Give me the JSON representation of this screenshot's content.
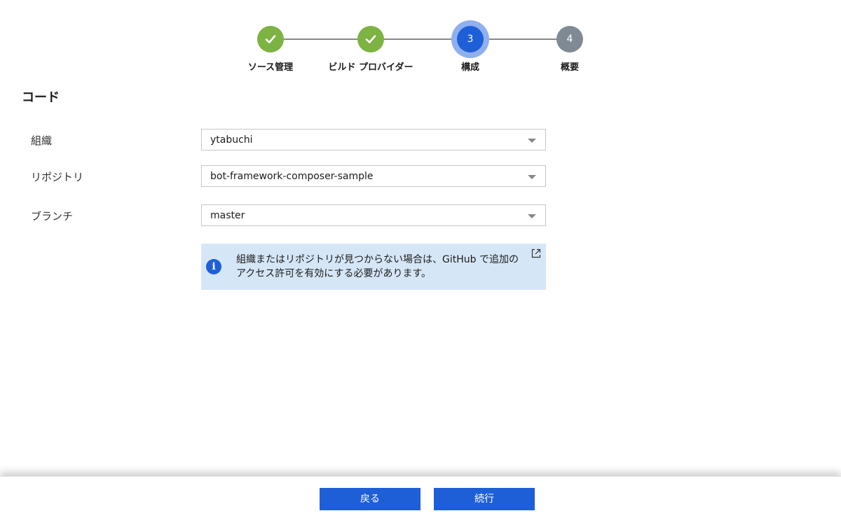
{
  "stepper": {
    "steps": [
      {
        "label": "ソース管理",
        "state": "done",
        "number": "1"
      },
      {
        "label": "ビルド プロバイダー",
        "state": "done",
        "number": "2"
      },
      {
        "label": "構成",
        "state": "current",
        "number": "3"
      },
      {
        "label": "概要",
        "state": "pending",
        "number": "4"
      }
    ]
  },
  "section": {
    "title": "コード"
  },
  "form": {
    "organization": {
      "label": "組織",
      "value": "ytabuchi"
    },
    "repository": {
      "label": "リポジトリ",
      "value": "bot-framework-composer-sample"
    },
    "branch": {
      "label": "ブランチ",
      "value": "master"
    }
  },
  "info": {
    "icon": "info-icon",
    "text": "組織またはリポジトリが見つからない場合は、GitHub で追加のアクセス許可を有効にする必要があります。",
    "link_icon": "external-link-icon"
  },
  "footer": {
    "back_label": "戻る",
    "continue_label": "続行"
  },
  "colors": {
    "accent": "#1e5fd8",
    "done": "#7cb342",
    "pending": "#7f8a95",
    "info_bg": "#d5e6f7"
  }
}
